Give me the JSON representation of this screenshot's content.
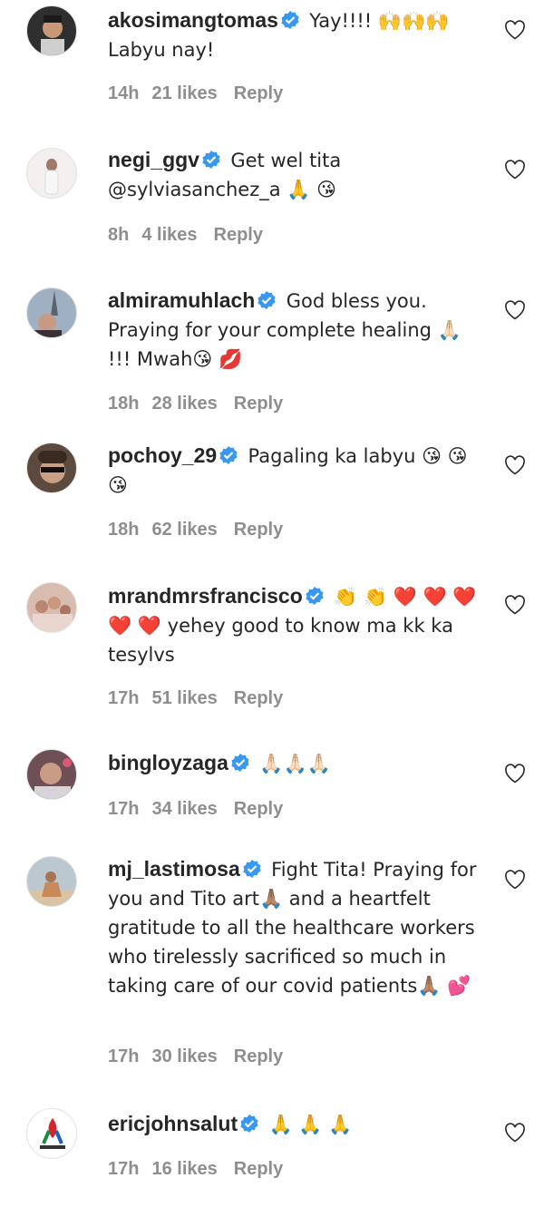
{
  "comments": [
    {
      "username": "akosimangtomas",
      "text": "Yay!!!! 🙌🙌🙌 Labyu nay!",
      "time": "14h",
      "likes": "21 likes",
      "reply": "Reply",
      "avatar_color": "#3a3a3a"
    },
    {
      "username": "negi_ggv",
      "text": "Get wel tita @sylviasanchez_a 🙏 😘",
      "time": "8h",
      "likes": "4 likes",
      "reply": "Reply",
      "avatar_color": "#e8e4e2"
    },
    {
      "username": "almiramuhlach",
      "text": "God bless you. Praying for your complete healing 🙏🏻 !!! Mwah😘 💋",
      "time": "18h",
      "likes": "28 likes",
      "reply": "Reply",
      "avatar_color": "#9aa6b4"
    },
    {
      "username": "pochoy_29",
      "text": "Pagaling ka labyu 😘 😘 😘",
      "time": "18h",
      "likes": "62 likes",
      "reply": "Reply",
      "avatar_color": "#6a5446"
    },
    {
      "username": "mrandmrsfrancisco",
      "text": "👏 👏 ❤️ ❤️ ❤️ ❤️ ❤️ yehey good to know ma kk ka tesylvs",
      "time": "17h",
      "likes": "51 likes",
      "reply": "Reply",
      "avatar_color": "#c8a79a"
    },
    {
      "username": "bingloyzaga",
      "text": "🙏🏻🙏🏻🙏🏻",
      "time": "17h",
      "likes": "34 likes",
      "reply": "Reply",
      "avatar_color": "#7a5a5e"
    },
    {
      "username": "mj_lastimosa",
      "text": "Fight Tita! Praying for you and Tito art🙏🏽  and a heartfelt gratitude to all the healthcare workers who tirelessly sacrificed so much in taking care of our covid patients🙏🏽 💕",
      "time": "17h",
      "likes": "30 likes",
      "reply": "Reply",
      "avatar_color": "#b9c3c9"
    },
    {
      "username": "ericjohnsalut",
      "text": "🙏 🙏 🙏",
      "time": "17h",
      "likes": "16 likes",
      "reply": "Reply",
      "avatar_color": "#ffffff"
    }
  ],
  "icons": {
    "verified_color": "#3897f0",
    "heart_icon": "heart-outline-icon"
  }
}
